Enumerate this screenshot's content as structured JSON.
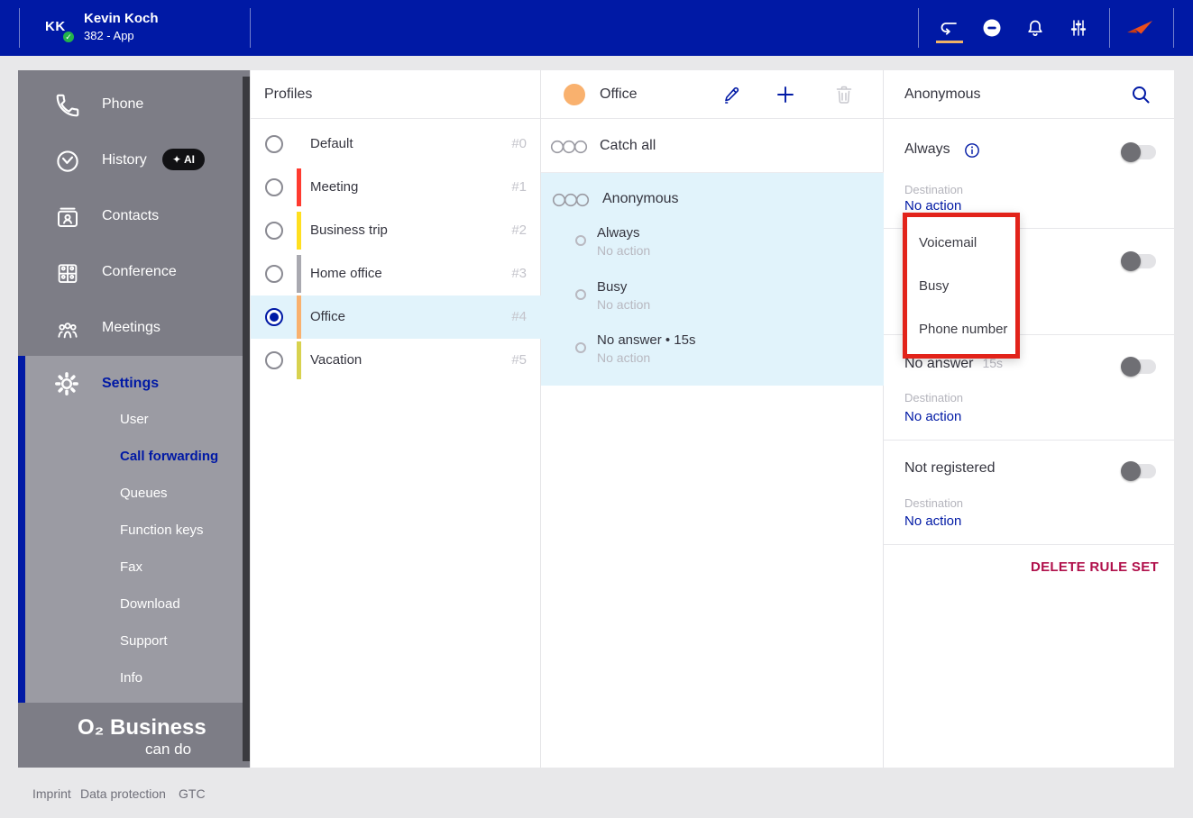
{
  "topbar": {
    "avatar_initials": "KK",
    "user_name": "Kevin Koch",
    "user_subtitle": "382 - App",
    "icons": [
      "call-forwarding-icon",
      "do-not-disturb-icon",
      "notifications-icon",
      "sliders-icon",
      "brand-arrow-icon"
    ],
    "brand_orange": "#ea4e1c",
    "active_underline_color": "#f0b266"
  },
  "sidebar": {
    "nav": [
      {
        "label": "Phone",
        "icon": "phone-icon"
      },
      {
        "label": "History",
        "icon": "history-icon",
        "badge": "✦ AI"
      },
      {
        "label": "Contacts",
        "icon": "contacts-icon"
      },
      {
        "label": "Conference",
        "icon": "conference-icon"
      },
      {
        "label": "Meetings",
        "icon": "meetings-icon"
      }
    ],
    "settings_label": "Settings",
    "settings_items": [
      "User",
      "Call forwarding",
      "Queues",
      "Function keys",
      "Fax",
      "Download",
      "Support",
      "Info"
    ],
    "active_settings_item": "Call forwarding",
    "logo_brand": "O₂ Business",
    "logo_tagline": "can do",
    "accent_blue": "#0019a5"
  },
  "profiles": {
    "title": "Profiles",
    "items": [
      {
        "name": "Default",
        "number": "#0",
        "color": ""
      },
      {
        "name": "Meeting",
        "number": "#1",
        "color": "#ff3b30"
      },
      {
        "name": "Business trip",
        "number": "#2",
        "color": "#ffdf20"
      },
      {
        "name": "Home office",
        "number": "#3",
        "color": "#a9a9b0"
      },
      {
        "name": "Office",
        "number": "#4",
        "color": "#f9b16e",
        "selected": true
      },
      {
        "name": "Vacation",
        "number": "#5",
        "color": "#d8d24f"
      }
    ]
  },
  "ruleset": {
    "title": "Office",
    "color": "#f9b16e",
    "catch_all_label": "Catch all",
    "selected_group_label": "Anonymous",
    "rules": [
      {
        "title": "Always",
        "subtitle": "No action"
      },
      {
        "title": "Busy",
        "subtitle": "No action"
      },
      {
        "title": "No answer • 15s",
        "subtitle": "No action"
      }
    ]
  },
  "detail": {
    "title": "Anonymous",
    "always": {
      "title": "Always",
      "dest_label": "Destination",
      "dest_value": "No action",
      "toggle_on": false
    },
    "busy": {
      "toggle_on": false
    },
    "no_answer": {
      "title": "No answer",
      "duration": "15s",
      "dest_label": "Destination",
      "dest_value": "No action",
      "toggle_on": false
    },
    "not_registered": {
      "title": "Not registered",
      "dest_label": "Destination",
      "dest_value": "No action",
      "toggle_on": false
    },
    "delete_label": "DELETE RULE SET",
    "delete_color": "#b0104b"
  },
  "dropdown": {
    "options": [
      "Voicemail",
      "Busy",
      "Phone number"
    ],
    "annotation_color": "#e2231a"
  },
  "footer": {
    "links": [
      "Imprint",
      "Data protection",
      "GTC"
    ]
  }
}
